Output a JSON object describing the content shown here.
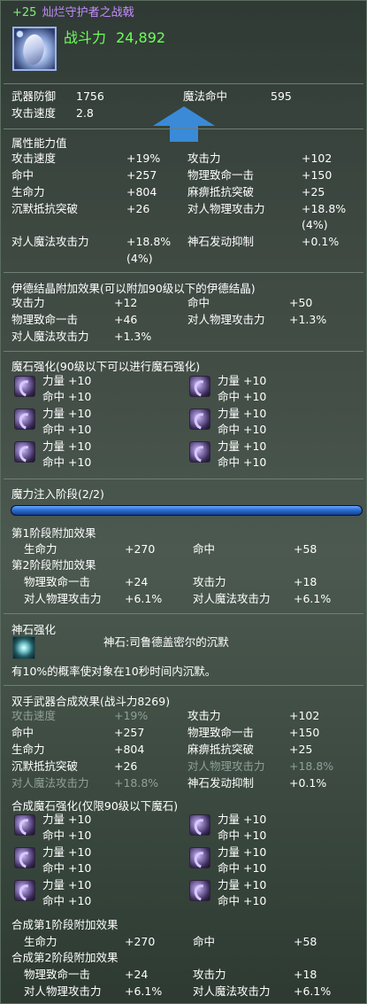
{
  "header": {
    "enchant": "+25",
    "item_name": "灿烂守护者之战戟",
    "combat_power_label": "战斗力",
    "combat_power_value": "24,892"
  },
  "base_stats": {
    "weapon_defense_label": "武器防御",
    "weapon_defense_value": "1756",
    "magic_accuracy_label": "魔法命中",
    "magic_accuracy_value": "595",
    "attack_speed_label": "攻击速度",
    "attack_speed_value": "2.8"
  },
  "attributes": {
    "title": "属性能力值",
    "rows": [
      {
        "l1": "攻击速度",
        "v1": "+19%",
        "l2": "攻击力",
        "v2": "+102"
      },
      {
        "l1": "命中",
        "v1": "+257",
        "l2": "物理致命一击",
        "v2": "+150"
      },
      {
        "l1": "生命力",
        "v1": "+804",
        "l2": "麻痹抵抗突破",
        "v2": "+25"
      },
      {
        "l1": "沉默抵抗突破",
        "v1": "+26",
        "l2": "对人物理攻击力",
        "v2": "+18.8%"
      }
    ],
    "wrap_right": "(4%)",
    "row5": {
      "l1": "对人魔法攻击力",
      "v1": "+18.8%",
      "l2": "神石发动抑制",
      "v2": "+0.1%"
    },
    "wrap_left": "(4%)"
  },
  "idian": {
    "title": "伊德结晶附加效果(可以附加90级以下的伊德结晶)",
    "rows": [
      {
        "l1": "攻击力",
        "v1": "+12",
        "l2": "命中",
        "v2": "+50"
      },
      {
        "l1": "物理致命一击",
        "v1": "+46",
        "l2": "对人物理攻击力",
        "v2": "+1.3%"
      }
    ],
    "row3": {
      "l1": "对人魔法攻击力",
      "v1": "+1.3%"
    }
  },
  "manastone": {
    "title": "魔石强化(90级以下可以进行魔石强化)",
    "slots": [
      "力量 +10",
      "命中 +10",
      "力量 +10",
      "命中 +10",
      "力量 +10",
      "命中 +10",
      "命中 +10",
      "命中 +10",
      "命中 +10"
    ],
    "left": [
      {
        "a": "力量 +10",
        "b": "命中 +10"
      },
      {
        "a": "力量 +10",
        "b": "命中 +10"
      },
      {
        "a": "力量 +10",
        "b": "命中 +10"
      }
    ],
    "right": [
      {
        "a": "力量 +10",
        "b": "命中 +10"
      },
      {
        "a": "力量 +10",
        "b": "命中 +10"
      },
      {
        "a": "力量 +10",
        "b": "命中 +10"
      }
    ]
  },
  "infusion": {
    "title": "魔力注入阶段(2/2)",
    "progress": 1.0,
    "stage1_title": "第1阶段附加效果",
    "stage1": {
      "l1": "生命力",
      "v1": "+270",
      "l2": "命中",
      "v2": "+58"
    },
    "stage2_title": "第2阶段附加效果",
    "stage2": [
      {
        "l1": "物理致命一击",
        "v1": "+24",
        "l2": "攻击力",
        "v2": "+18"
      },
      {
        "l1": "对人物理攻击力",
        "v1": "+6.1%",
        "l2": "对人魔法攻击力",
        "v2": "+6.1%"
      }
    ]
  },
  "godstone": {
    "title": "神石强化",
    "name": "神石:司鲁德盖密尔的沉默",
    "desc": "有10%的概率使对象在10秒时间内沉默。"
  },
  "fusion": {
    "title": "双手武器合成效果(战斗力8269)",
    "rows": [
      {
        "l1": "攻击速度",
        "v1": "+19%",
        "l2": "攻击力",
        "v2": "+102",
        "dimL": true,
        "dimR": false
      },
      {
        "l1": "命中",
        "v1": "+257",
        "l2": "物理致命一击",
        "v2": "+150",
        "dimL": false,
        "dimR": false
      },
      {
        "l1": "生命力",
        "v1": "+804",
        "l2": "麻痹抵抗突破",
        "v2": "+25",
        "dimL": false,
        "dimR": false
      },
      {
        "l1": "沉默抵抗突破",
        "v1": "+26",
        "l2": "对人物理攻击力",
        "v2": "+18.8%",
        "dimL": false,
        "dimR": true
      },
      {
        "l1": "对人魔法攻击力",
        "v1": "+18.8%",
        "l2": "神石发动抑制",
        "v2": "+0.1%",
        "dimL": true,
        "dimR": false
      }
    ],
    "ms_title": "合成魔石强化(仅限90级以下魔石)",
    "left": [
      {
        "a": "力量 +10",
        "b": "命中 +10"
      },
      {
        "a": "力量 +10",
        "b": "命中 +10"
      },
      {
        "a": "力量 +10",
        "b": "命中 +10"
      }
    ],
    "right": [
      {
        "a": "力量 +10",
        "b": "命中 +10"
      },
      {
        "a": "力量 +10",
        "b": "命中 +10"
      },
      {
        "a": "力量 +10",
        "b": "命中 +10"
      }
    ],
    "stage1_title": "合成第1阶段附加效果",
    "stage1": {
      "l1": "生命力",
      "v1": "+270",
      "l2": "命中",
      "v2": "+58"
    },
    "stage2_title": "合成第2阶段附加效果",
    "stage2": [
      {
        "l1": "物理致命一击",
        "v1": "+24",
        "l2": "攻击力",
        "v2": "+18"
      },
      {
        "l1": "对人物理攻击力",
        "v1": "+6.1%",
        "l2": "对人魔法攻击力",
        "v2": "+6.1%"
      }
    ]
  },
  "colors": {
    "enchant": "#7ef07a",
    "item_name": "#c58cff",
    "combat_power": "#6dff5a",
    "progress": "#2b6fd4"
  }
}
